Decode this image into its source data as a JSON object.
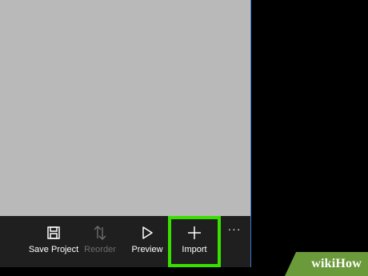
{
  "toolbar": {
    "save_project_label": "Save Project",
    "reorder_label": "Reorder",
    "preview_label": "Preview",
    "import_label": "Import",
    "more_label": "···"
  },
  "icons": {
    "save": "save-icon",
    "reorder": "reorder-icon",
    "preview": "play-icon",
    "import": "plus-icon"
  },
  "colors": {
    "highlight": "#38e000",
    "canvas": "#b9b9b9",
    "toolbar_bg": "#1f1f1f",
    "window_border": "#3a78c8",
    "watermark_bg": "#6b9a3a"
  },
  "watermark": {
    "text": "wikiHow"
  }
}
